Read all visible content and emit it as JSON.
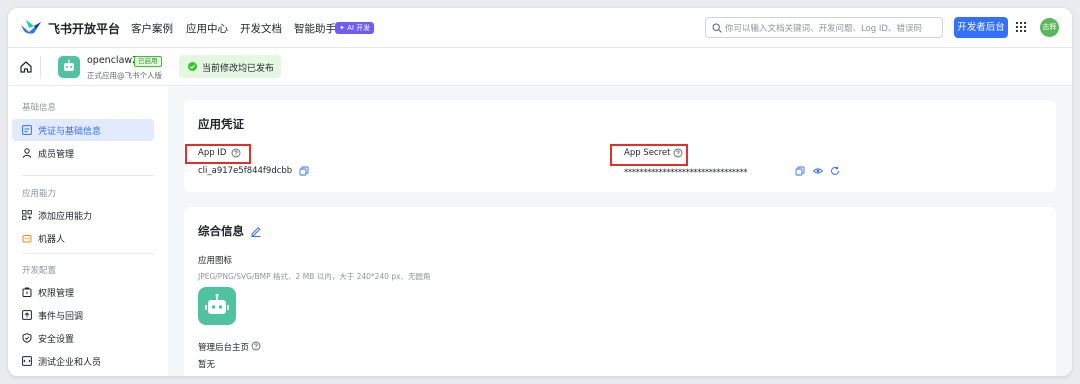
{
  "nav": {
    "brand": "飞书开放平台",
    "items": [
      "客户案例",
      "应用中心",
      "开发文档",
      "智能助手"
    ],
    "ai_badge": "✦ AI 开发",
    "search_placeholder": "你可以输入文档关键词、开发问题、Log ID、错误码",
    "dev_button": "开发者后台",
    "avatar_text": "志辉"
  },
  "appbar": {
    "app_name": "openclaw2",
    "status_badge": "已启用",
    "app_subtitle": "正式应用@飞书个人版",
    "publish_status": "当前修改均已发布"
  },
  "sidebar": {
    "groups": [
      {
        "title": "基础信息",
        "items": [
          "凭证与基础信息",
          "成员管理"
        ]
      },
      {
        "title": "应用能力",
        "items": [
          "添加应用能力",
          "机器人"
        ]
      },
      {
        "title": "开发配置",
        "items": [
          "权限管理",
          "事件与回调",
          "安全设置",
          "测试企业和人员"
        ]
      }
    ],
    "active_item": "凭证与基础信息"
  },
  "credentials": {
    "title": "应用凭证",
    "app_id_label": "App ID",
    "app_id_value": "cli_a917e5f844f9dcbb",
    "app_secret_label": "App Secret",
    "app_secret_value": "********************************"
  },
  "info": {
    "title": "综合信息",
    "icon_label": "应用图标",
    "icon_hint": "JPEG/PNG/SVG/BMP 格式、2 MB 以内，大于 240*240 px、无圆角",
    "admin_home_label": "管理后台主页",
    "admin_home_value": "暂无"
  },
  "colors": {
    "accent": "#3370ff",
    "highlight": "#e0302a",
    "app_icon": "#4fc3a1",
    "success_bg": "#e4f7e1"
  }
}
